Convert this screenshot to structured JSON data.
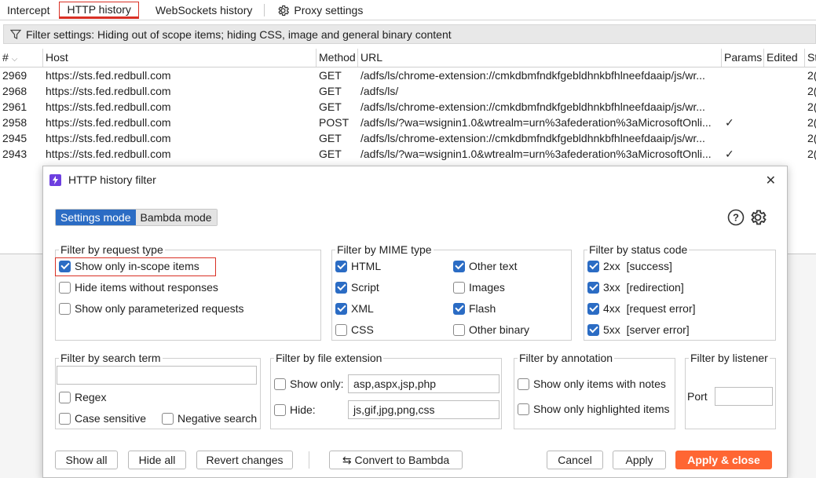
{
  "tabs": [
    "Intercept",
    "HTTP history",
    "WebSockets history",
    "Proxy settings"
  ],
  "filter_bar": {
    "text": "Filter settings: Hiding out of scope items;  hiding CSS, image and general binary content"
  },
  "table": {
    "headers": [
      "#",
      "Host",
      "Method",
      "URL",
      "Params",
      "Edited",
      "St"
    ],
    "rows": [
      {
        "num": "2969",
        "host": "https://sts.fed.redbull.com",
        "method": "GET",
        "url": "/adfs/ls/chrome-extension://cmkdbmfndkfgebldhnkbfhlneefdaaip/js/wr...",
        "params": "",
        "edited": "",
        "status": "2("
      },
      {
        "num": "2968",
        "host": "https://sts.fed.redbull.com",
        "method": "GET",
        "url": "/adfs/ls/",
        "params": "",
        "edited": "",
        "status": "2("
      },
      {
        "num": "2961",
        "host": "https://sts.fed.redbull.com",
        "method": "GET",
        "url": "/adfs/ls/chrome-extension://cmkdbmfndkfgebldhnkbfhlneefdaaip/js/wr...",
        "params": "",
        "edited": "",
        "status": "2("
      },
      {
        "num": "2958",
        "host": "https://sts.fed.redbull.com",
        "method": "POST",
        "url": "/adfs/ls/?wa=wsignin1.0&wtrealm=urn%3afederation%3aMicrosoftOnli...",
        "params": "✓",
        "edited": "",
        "status": "2("
      },
      {
        "num": "2945",
        "host": "https://sts.fed.redbull.com",
        "method": "GET",
        "url": "/adfs/ls/chrome-extension://cmkdbmfndkfgebldhnkbfhlneefdaaip/js/wr...",
        "params": "",
        "edited": "",
        "status": "2("
      },
      {
        "num": "2943",
        "host": "https://sts.fed.redbull.com",
        "method": "GET",
        "url": "/adfs/ls/?wa=wsignin1.0&wtrealm=urn%3afederation%3aMicrosoftOnli...",
        "params": "✓",
        "edited": "",
        "status": "2("
      }
    ]
  },
  "dialog": {
    "title": "HTTP history filter",
    "modes": [
      "Settings mode",
      "Bambda mode"
    ],
    "request_type": {
      "title": "Filter by request type",
      "items": [
        {
          "label": "Show only in-scope items",
          "checked": true
        },
        {
          "label": "Hide items without responses",
          "checked": false
        },
        {
          "label": "Show only parameterized requests",
          "checked": false
        }
      ]
    },
    "mime": {
      "title": "Filter by MIME type",
      "items": [
        {
          "label": "HTML",
          "checked": true
        },
        {
          "label": "Other text",
          "checked": true
        },
        {
          "label": "Script",
          "checked": true
        },
        {
          "label": "Images",
          "checked": false
        },
        {
          "label": "XML",
          "checked": true
        },
        {
          "label": "Flash",
          "checked": true
        },
        {
          "label": "CSS",
          "checked": false
        },
        {
          "label": "Other binary",
          "checked": false
        }
      ]
    },
    "status": {
      "title": "Filter by status code",
      "items": [
        {
          "label": "2xx  [success]",
          "checked": true
        },
        {
          "label": "3xx  [redirection]",
          "checked": true
        },
        {
          "label": "4xx  [request error]",
          "checked": true
        },
        {
          "label": "5xx  [server error]",
          "checked": true
        }
      ]
    },
    "search": {
      "title": "Filter by search term",
      "value": "",
      "regex": "Regex",
      "case_sensitive": "Case sensitive",
      "negative": "Negative search"
    },
    "extension": {
      "title": "Filter by file extension",
      "show_only_label": "Show only:",
      "show_only_value": "asp,aspx,jsp,php",
      "hide_label": "Hide:",
      "hide_value": "js,gif,jpg,png,css"
    },
    "annotation": {
      "title": "Filter by annotation",
      "notes": "Show only items with notes",
      "highlighted": "Show only highlighted items"
    },
    "listener": {
      "title": "Filter by listener",
      "port_label": "Port",
      "port_value": ""
    },
    "buttons": {
      "show_all": "Show all",
      "hide_all": "Hide all",
      "revert": "Revert changes",
      "convert": "Convert to Bambda",
      "cancel": "Cancel",
      "apply": "Apply",
      "apply_close": "Apply & close"
    }
  },
  "colors": {
    "accent_blue": "#2b6cc4",
    "apply_orange": "#ff6633",
    "highlight_red": "#d93025"
  }
}
